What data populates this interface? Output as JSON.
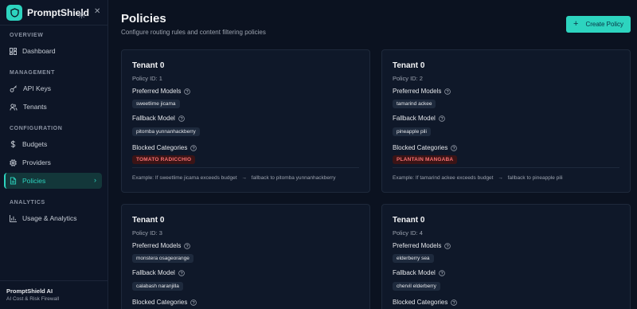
{
  "brand": {
    "name": "PromptShield"
  },
  "sidebar": {
    "sections": [
      {
        "label": "OVERVIEW"
      },
      {
        "label": "MANAGEMENT"
      },
      {
        "label": "CONFIGURATION"
      },
      {
        "label": "ANALYTICS"
      }
    ],
    "items": [
      {
        "label": "Dashboard",
        "icon": "dashboard-icon"
      },
      {
        "label": "API Keys",
        "icon": "key-icon"
      },
      {
        "label": "Tenants",
        "icon": "users-icon"
      },
      {
        "label": "Budgets",
        "icon": "dollar-icon"
      },
      {
        "label": "Providers",
        "icon": "chip-icon"
      },
      {
        "label": "Policies",
        "icon": "document-icon",
        "active": true
      },
      {
        "label": "Usage & Analytics",
        "icon": "bar-chart-icon"
      }
    ],
    "footer": {
      "title": "PromptShield AI",
      "subtitle": "AI Cost & Risk Firewall"
    }
  },
  "header": {
    "title": "Policies",
    "subtitle": "Configure routing rules and content filtering policies",
    "create_label": "Create Policy"
  },
  "labels": {
    "preferred": "Preferred Models",
    "fallback": "Fallback Model",
    "blocked": "Blocked Categories"
  },
  "policies": [
    {
      "tenant": "Tenant 0",
      "policy_id": "Policy ID: 1",
      "preferred": "sweetlime jicama",
      "fallback": "pitomba yunnanhackberry",
      "blocked": "TOMATO RADICCHIO",
      "example_prefix": "Example:",
      "example_condition": "If sweetlime jicama exceeds budget",
      "example_result": "fallback to pitomba yunnanhackberry"
    },
    {
      "tenant": "Tenant 0",
      "policy_id": "Policy ID: 2",
      "preferred": "tamarind ackee",
      "fallback": "pineapple pili",
      "blocked": "PLANTAIN MANGABA",
      "example_prefix": "Example:",
      "example_condition": "If tamarind ackee exceeds budget",
      "example_result": "fallback to pineapple pili"
    },
    {
      "tenant": "Tenant 0",
      "policy_id": "Policy ID: 3",
      "preferred": "monstera osageorange",
      "fallback": "calabash naranjilla"
    },
    {
      "tenant": "Tenant 0",
      "policy_id": "Policy ID: 4",
      "preferred": "elderberry sea",
      "fallback": "chervil elderberry"
    }
  ],
  "colors": {
    "accent": "#2dd4bf",
    "background": "#0b1220",
    "card": "#0f1829",
    "danger_text": "#f87171",
    "danger_bg": "#3b1416"
  }
}
